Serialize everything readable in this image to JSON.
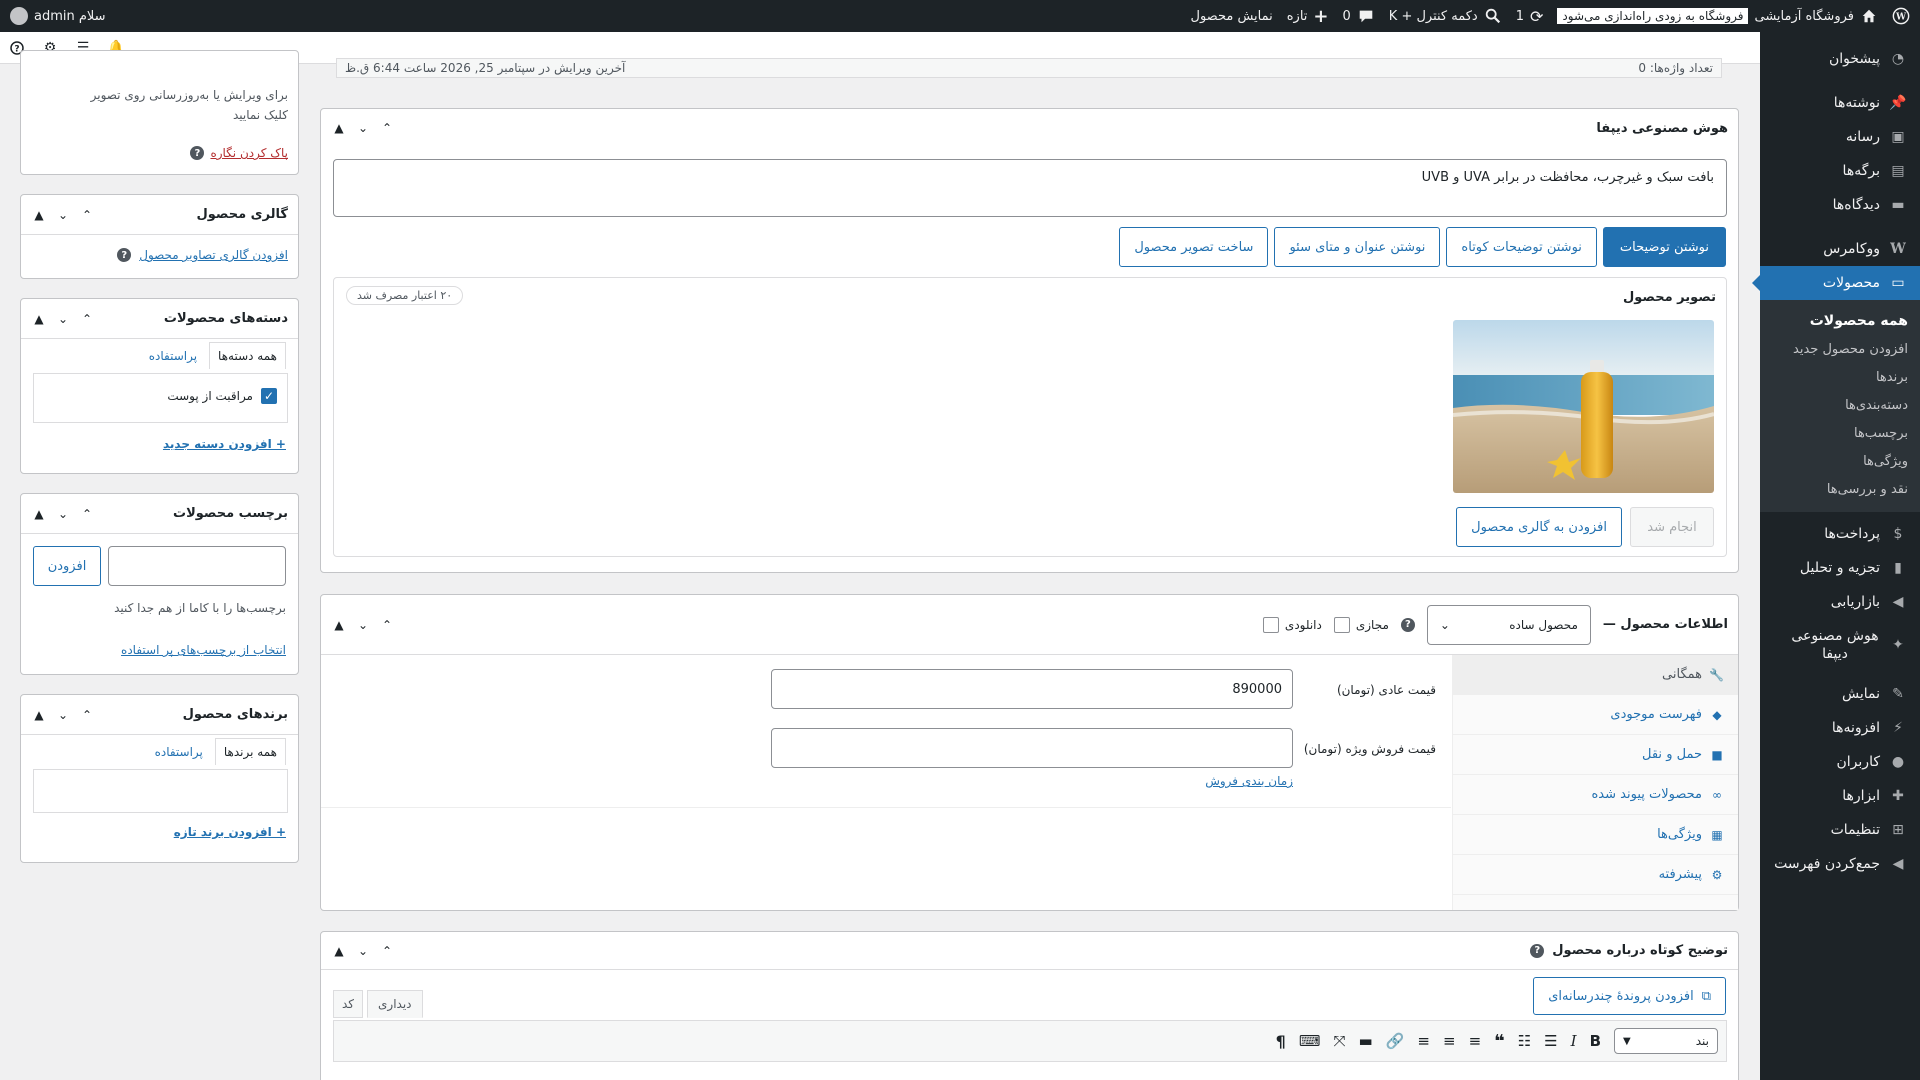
{
  "adminbar": {
    "site_name": "فروشگاه آزمایشی",
    "coming_soon": "فروشگاه به زودی راه‌اندازی می‌شود",
    "updates_count": "1",
    "command_palette": "دکمه کنترل + K",
    "comments_count": "0",
    "new_label": "تازه",
    "view_product": "نمایش محصول",
    "greeting": "سلام admin"
  },
  "sidebar": {
    "items": [
      {
        "label": "پیشخوان",
        "icon": "dashboard-icon"
      },
      {
        "label": "نوشته‌ها",
        "icon": "pin-icon"
      },
      {
        "label": "رسانه",
        "icon": "media-icon"
      },
      {
        "label": "برگه‌ها",
        "icon": "pages-icon"
      },
      {
        "label": "دیدگاه‌ها",
        "icon": "comments-icon"
      },
      {
        "label": "ووکامرس",
        "icon": "woocommerce-icon"
      },
      {
        "label": "محصولات",
        "icon": "products-icon"
      },
      {
        "label": "پرداخت‌ها",
        "icon": "payments-icon"
      },
      {
        "label": "تجزیه و تحلیل",
        "icon": "analytics-icon"
      },
      {
        "label": "بازاریابی",
        "icon": "megaphone-icon"
      },
      {
        "label": "هوش مصنوعی دیپفا",
        "icon": "sparkle-icon"
      },
      {
        "label": "نمایش",
        "icon": "appearance-icon"
      },
      {
        "label": "افزونه‌ها",
        "icon": "plugins-icon"
      },
      {
        "label": "کاربران",
        "icon": "users-icon"
      },
      {
        "label": "ابزارها",
        "icon": "tools-icon"
      },
      {
        "label": "تنظیمات",
        "icon": "settings-icon"
      },
      {
        "label": "جمع‌کردن فهرست",
        "icon": "collapse-icon"
      }
    ],
    "submenu": [
      "همه محصولات",
      "افزودن محصول جدید",
      "برندها",
      "دسته‌بندی‌ها",
      "برچسب‌ها",
      "ویژگی‌ها",
      "نقد و بررسی‌ها"
    ]
  },
  "status": {
    "word_count": "تعداد واژه‌ها: 0",
    "last_edit": "آخرین ویرایش در سپتامبر 25, 2026 ساعت 6:44 ق.ظ"
  },
  "ai_panel": {
    "title": "هوش مصنوعی دیپفا",
    "prompt_text": "بافت سبک و غیرچرب، محافظت در برابر UVA و UVB",
    "buttons": [
      "نوشتن توضیحات",
      "نوشتن توضیحات کوتاه",
      "نوشتن عنوان و متای سئو",
      "ساخت تصویر محصول"
    ],
    "image_section_title": "تصویر محصول",
    "credits_badge": "۲۰ اعتبار مصرف شد",
    "done_button": "انجام شد",
    "add_gallery_button": "افزودن به گالری محصول"
  },
  "product_data": {
    "title": "اطلاعات محصول —",
    "product_type": "محصول ساده",
    "virtual_label": "مجازی",
    "download_label": "دانلودی",
    "tabs": [
      {
        "label": "همگانی",
        "icon": "wrench-icon"
      },
      {
        "label": "فهرست موجودی",
        "icon": "tag-icon"
      },
      {
        "label": "حمل و نقل",
        "icon": "truck-icon"
      },
      {
        "label": "محصولات پیوند شده",
        "icon": "link-icon"
      },
      {
        "label": "ویژگی‌ها",
        "icon": "table-icon"
      },
      {
        "label": "پیشرفته",
        "icon": "gear-icon"
      }
    ],
    "regular_price_label": "قیمت عادی (تومان)",
    "regular_price_value": "890000",
    "sale_price_label": "قیمت فروش ویژه (تومان)",
    "sale_price_value": "",
    "schedule_link": "زمان بندی فروش"
  },
  "short_desc": {
    "title": "توضیح کوتاه درباره محصول",
    "add_media": "افزودن پروندهٔ چندرسانه‌ای",
    "tab_visual": "دیداری",
    "tab_code": "کد",
    "format_select": "بند"
  },
  "left": {
    "image_hint": "برای ویرایش یا به‌روزرسانی روی تصویر کلیک نمایید",
    "remove_image": "پاک کردن نگاره",
    "gallery_title": "گالری محصول",
    "gallery_link": "افزودن گالری تصاویر محصول",
    "categories_title": "دسته‌های محصولات",
    "cat_tab_all": "همه دسته‌ها",
    "cat_tab_popular": "پراستفاده",
    "cat_item": "مراقبت از پوست",
    "add_category": "+ افزودن دسته جدید",
    "tags_title": "برچسب محصولات",
    "tag_add_button": "افزودن",
    "tag_hint": "برچسب‌ها را با کاما از هم جدا کنید",
    "tag_choose": "انتخاب از برچسب‌های پر استفاده",
    "brands_title": "برندهای محصول",
    "brand_tab_all": "همه برندها",
    "brand_tab_popular": "پراستفاده",
    "add_brand": "+ افزودن برند تازه"
  },
  "colors": {
    "accent": "#2271b1",
    "admin_dark": "#1d2327"
  }
}
